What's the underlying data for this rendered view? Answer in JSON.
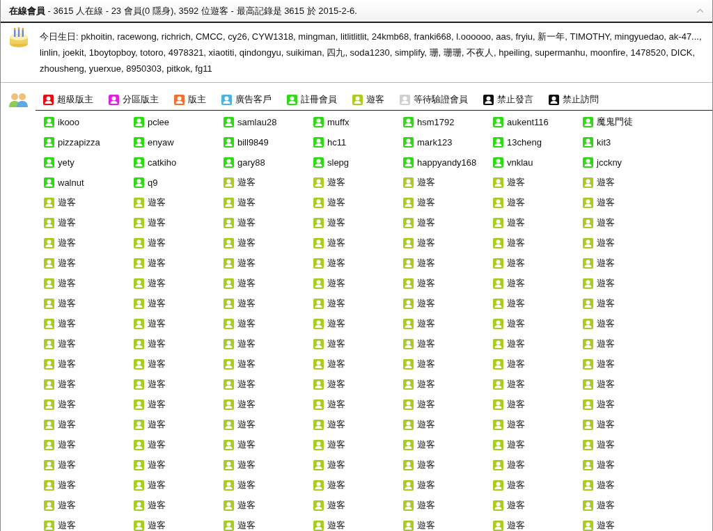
{
  "header": {
    "title": "**在線會員** - 3615 人在線 - 23 會員(0 隱身), 3592 位遊客 - 最高記錄是 3615 於 2015-2-6."
  },
  "birthday": {
    "text": "今日生日: pkhoitin, racewong, richrich, CMCC, cy26, CYW1318, mingman, litlitlitlit, 24kmb68, franki668, l.oooooo, aas, fryiu, 新一年, TIMOTHY, mingyuedao, ak-47..., linlin, joekit, 1boytopboy, totoro, 4978321, xiaotiti, qindongyu, suikiman, 四九, soda1230, simplify, 珊, 珊珊, 不夜人, hpeiling, supermanhu, moonfire, 1478520, DICK, zhousheng, yuerxue, 8950303, pitkok, fg11"
  },
  "legend": [
    {
      "label": "超級版主",
      "color": "#e01010"
    },
    {
      "label": "分區版主",
      "color": "#e020e0"
    },
    {
      "label": "版主",
      "color": "#f07030"
    },
    {
      "label": "廣告客戶",
      "color": "#50b0e0"
    },
    {
      "label": "註冊會員",
      "color": "#30d818"
    },
    {
      "label": "遊客",
      "color": "#a8cc20"
    },
    {
      "label": "等待驗證會員",
      "color": "#d0d0d0"
    },
    {
      "label": "禁止發言",
      "color": "#111111"
    },
    {
      "label": "禁止訪問",
      "color": "#111111"
    }
  ],
  "users": [
    {
      "name": "ikooo",
      "kind": "member"
    },
    {
      "name": "pclee",
      "kind": "member"
    },
    {
      "name": "samlau28",
      "kind": "member"
    },
    {
      "name": "muffx",
      "kind": "member"
    },
    {
      "name": "hsm1792",
      "kind": "member"
    },
    {
      "name": "aukent116",
      "kind": "member"
    },
    {
      "name": "魔鬼門徒",
      "kind": "member"
    },
    {
      "name": "pizzapizza",
      "kind": "member"
    },
    {
      "name": "enyaw",
      "kind": "member"
    },
    {
      "name": "bill9849",
      "kind": "member"
    },
    {
      "name": "hc11",
      "kind": "member"
    },
    {
      "name": "mark123",
      "kind": "member"
    },
    {
      "name": "13cheng",
      "kind": "member"
    },
    {
      "name": "kit3",
      "kind": "member"
    },
    {
      "name": "yety",
      "kind": "member"
    },
    {
      "name": "catkiho",
      "kind": "member"
    },
    {
      "name": "gary88",
      "kind": "member"
    },
    {
      "name": "slepg",
      "kind": "member"
    },
    {
      "name": "happyandy168",
      "kind": "member"
    },
    {
      "name": "vnklau",
      "kind": "member"
    },
    {
      "name": "jcckny",
      "kind": "member"
    },
    {
      "name": "walnut",
      "kind": "member"
    },
    {
      "name": "q9",
      "kind": "member"
    },
    {
      "name": "遊客",
      "kind": "guest"
    },
    {
      "name": "遊客",
      "kind": "guest"
    },
    {
      "name": "遊客",
      "kind": "guest"
    },
    {
      "name": "遊客",
      "kind": "guest"
    },
    {
      "name": "遊客",
      "kind": "guest"
    },
    {
      "name": "遊客",
      "kind": "guest"
    },
    {
      "name": "遊客",
      "kind": "guest"
    },
    {
      "name": "遊客",
      "kind": "guest"
    },
    {
      "name": "遊客",
      "kind": "guest"
    },
    {
      "name": "遊客",
      "kind": "guest"
    },
    {
      "name": "遊客",
      "kind": "guest"
    },
    {
      "name": "遊客",
      "kind": "guest"
    },
    {
      "name": "遊客",
      "kind": "guest"
    },
    {
      "name": "遊客",
      "kind": "guest"
    },
    {
      "name": "遊客",
      "kind": "guest"
    },
    {
      "name": "遊客",
      "kind": "guest"
    },
    {
      "name": "遊客",
      "kind": "guest"
    },
    {
      "name": "遊客",
      "kind": "guest"
    },
    {
      "name": "遊客",
      "kind": "guest"
    },
    {
      "name": "遊客",
      "kind": "guest"
    },
    {
      "name": "遊客",
      "kind": "guest"
    },
    {
      "name": "遊客",
      "kind": "guest"
    },
    {
      "name": "遊客",
      "kind": "guest"
    },
    {
      "name": "遊客",
      "kind": "guest"
    },
    {
      "name": "遊客",
      "kind": "guest"
    },
    {
      "name": "遊客",
      "kind": "guest"
    },
    {
      "name": "遊客",
      "kind": "guest"
    },
    {
      "name": "遊客",
      "kind": "guest"
    },
    {
      "name": "遊客",
      "kind": "guest"
    },
    {
      "name": "遊客",
      "kind": "guest"
    },
    {
      "name": "遊客",
      "kind": "guest"
    },
    {
      "name": "遊客",
      "kind": "guest"
    },
    {
      "name": "遊客",
      "kind": "guest"
    },
    {
      "name": "遊客",
      "kind": "guest"
    },
    {
      "name": "遊客",
      "kind": "guest"
    },
    {
      "name": "遊客",
      "kind": "guest"
    },
    {
      "name": "遊客",
      "kind": "guest"
    },
    {
      "name": "遊客",
      "kind": "guest"
    },
    {
      "name": "遊客",
      "kind": "guest"
    },
    {
      "name": "遊客",
      "kind": "guest"
    },
    {
      "name": "遊客",
      "kind": "guest"
    },
    {
      "name": "遊客",
      "kind": "guest"
    },
    {
      "name": "遊客",
      "kind": "guest"
    },
    {
      "name": "遊客",
      "kind": "guest"
    },
    {
      "name": "遊客",
      "kind": "guest"
    },
    {
      "name": "遊客",
      "kind": "guest"
    },
    {
      "name": "遊客",
      "kind": "guest"
    },
    {
      "name": "遊客",
      "kind": "guest"
    },
    {
      "name": "遊客",
      "kind": "guest"
    },
    {
      "name": "遊客",
      "kind": "guest"
    },
    {
      "name": "遊客",
      "kind": "guest"
    },
    {
      "name": "遊客",
      "kind": "guest"
    },
    {
      "name": "遊客",
      "kind": "guest"
    },
    {
      "name": "遊客",
      "kind": "guest"
    },
    {
      "name": "遊客",
      "kind": "guest"
    },
    {
      "name": "遊客",
      "kind": "guest"
    },
    {
      "name": "遊客",
      "kind": "guest"
    },
    {
      "name": "遊客",
      "kind": "guest"
    },
    {
      "name": "遊客",
      "kind": "guest"
    },
    {
      "name": "遊客",
      "kind": "guest"
    },
    {
      "name": "遊客",
      "kind": "guest"
    },
    {
      "name": "遊客",
      "kind": "guest"
    },
    {
      "name": "遊客",
      "kind": "guest"
    },
    {
      "name": "遊客",
      "kind": "guest"
    },
    {
      "name": "遊客",
      "kind": "guest"
    },
    {
      "name": "遊客",
      "kind": "guest"
    },
    {
      "name": "遊客",
      "kind": "guest"
    },
    {
      "name": "遊客",
      "kind": "guest"
    },
    {
      "name": "遊客",
      "kind": "guest"
    },
    {
      "name": "遊客",
      "kind": "guest"
    },
    {
      "name": "遊客",
      "kind": "guest"
    },
    {
      "name": "遊客",
      "kind": "guest"
    },
    {
      "name": "遊客",
      "kind": "guest"
    },
    {
      "name": "遊客",
      "kind": "guest"
    },
    {
      "name": "遊客",
      "kind": "guest"
    },
    {
      "name": "遊客",
      "kind": "guest"
    },
    {
      "name": "遊客",
      "kind": "guest"
    },
    {
      "name": "遊客",
      "kind": "guest"
    },
    {
      "name": "遊客",
      "kind": "guest"
    },
    {
      "name": "遊客",
      "kind": "guest"
    },
    {
      "name": "遊客",
      "kind": "guest"
    },
    {
      "name": "遊客",
      "kind": "guest"
    },
    {
      "name": "遊客",
      "kind": "guest"
    },
    {
      "name": "遊客",
      "kind": "guest"
    },
    {
      "name": "遊客",
      "kind": "guest"
    },
    {
      "name": "遊客",
      "kind": "guest"
    },
    {
      "name": "遊客",
      "kind": "guest"
    },
    {
      "name": "遊客",
      "kind": "guest"
    },
    {
      "name": "遊客",
      "kind": "guest"
    },
    {
      "name": "遊客",
      "kind": "guest"
    },
    {
      "name": "遊客",
      "kind": "guest"
    },
    {
      "name": "遊客",
      "kind": "guest"
    },
    {
      "name": "遊客",
      "kind": "guest"
    },
    {
      "name": "遊客",
      "kind": "guest"
    },
    {
      "name": "遊客",
      "kind": "guest"
    },
    {
      "name": "遊客",
      "kind": "guest"
    },
    {
      "name": "遊客",
      "kind": "guest"
    },
    {
      "name": "遊客",
      "kind": "guest"
    },
    {
      "name": "遊客",
      "kind": "guest"
    },
    {
      "name": "遊客",
      "kind": "guest"
    },
    {
      "name": "遊客",
      "kind": "guest"
    },
    {
      "name": "遊客",
      "kind": "guest"
    },
    {
      "name": "遊客",
      "kind": "guest"
    },
    {
      "name": "遊客",
      "kind": "guest"
    },
    {
      "name": "遊客",
      "kind": "guest"
    },
    {
      "name": "遊客",
      "kind": "guest"
    },
    {
      "name": "遊客",
      "kind": "guest"
    },
    {
      "name": "遊客",
      "kind": "guest"
    },
    {
      "name": "遊客",
      "kind": "guest"
    },
    {
      "name": "遊客",
      "kind": "guest"
    },
    {
      "name": "遊客",
      "kind": "guest"
    },
    {
      "name": "遊客",
      "kind": "guest"
    },
    {
      "name": "遊客",
      "kind": "guest"
    },
    {
      "name": "遊客",
      "kind": "guest"
    },
    {
      "name": "遊客",
      "kind": "guest"
    },
    {
      "name": "遊客",
      "kind": "guest"
    },
    {
      "name": "遊客",
      "kind": "guest"
    },
    {
      "name": "遊客",
      "kind": "guest"
    },
    {
      "name": "遊客",
      "kind": "guest"
    },
    {
      "name": "遊客",
      "kind": "guest"
    },
    {
      "name": "遊客",
      "kind": "guest"
    },
    {
      "name": "遊客",
      "kind": "guest"
    },
    {
      "name": "遊客",
      "kind": "guest"
    },
    {
      "name": "遊客",
      "kind": "guest"
    }
  ]
}
